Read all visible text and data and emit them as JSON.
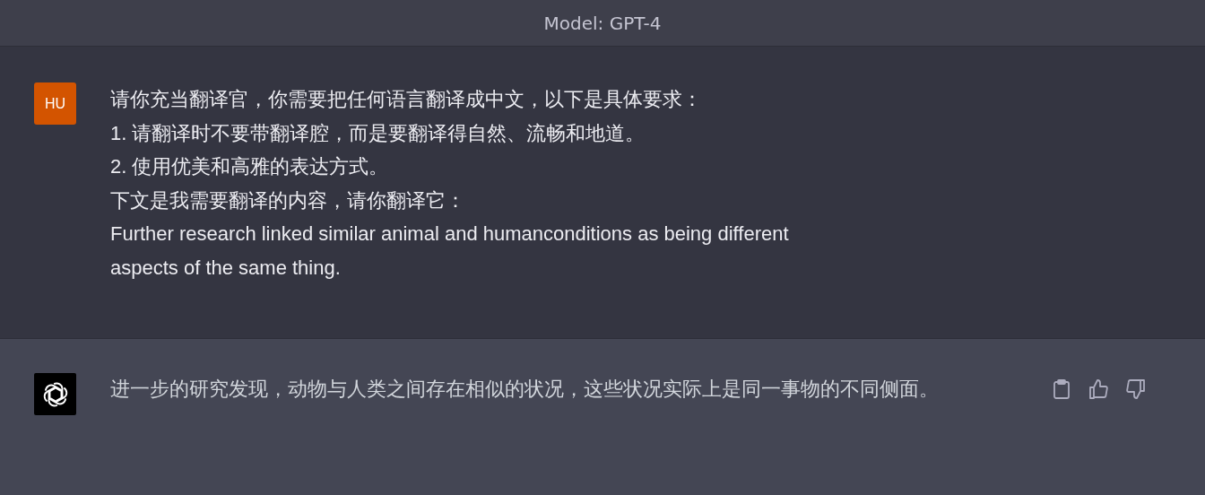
{
  "header": {
    "model_label": "Model: GPT-4"
  },
  "messages": [
    {
      "kind": "user",
      "avatar": "HU",
      "lines": [
        "请你充当翻译官，你需要把任何语言翻译成中文，以下是具体要求：",
        "1. 请翻译时不要带翻译腔，而是要翻译得自然、流畅和地道。",
        "2. 使用优美和高雅的表达方式。",
        "下文是我需要翻译的内容，请你翻译它：",
        "Further research linked similar animal and humanconditions as being different",
        "aspects of the same thing."
      ]
    },
    {
      "kind": "assistant",
      "lines": [
        "进一步的研究发现，动物与人类之间存在相似的状况，这些状况实际上是同一事物的不同侧面。"
      ]
    }
  ]
}
